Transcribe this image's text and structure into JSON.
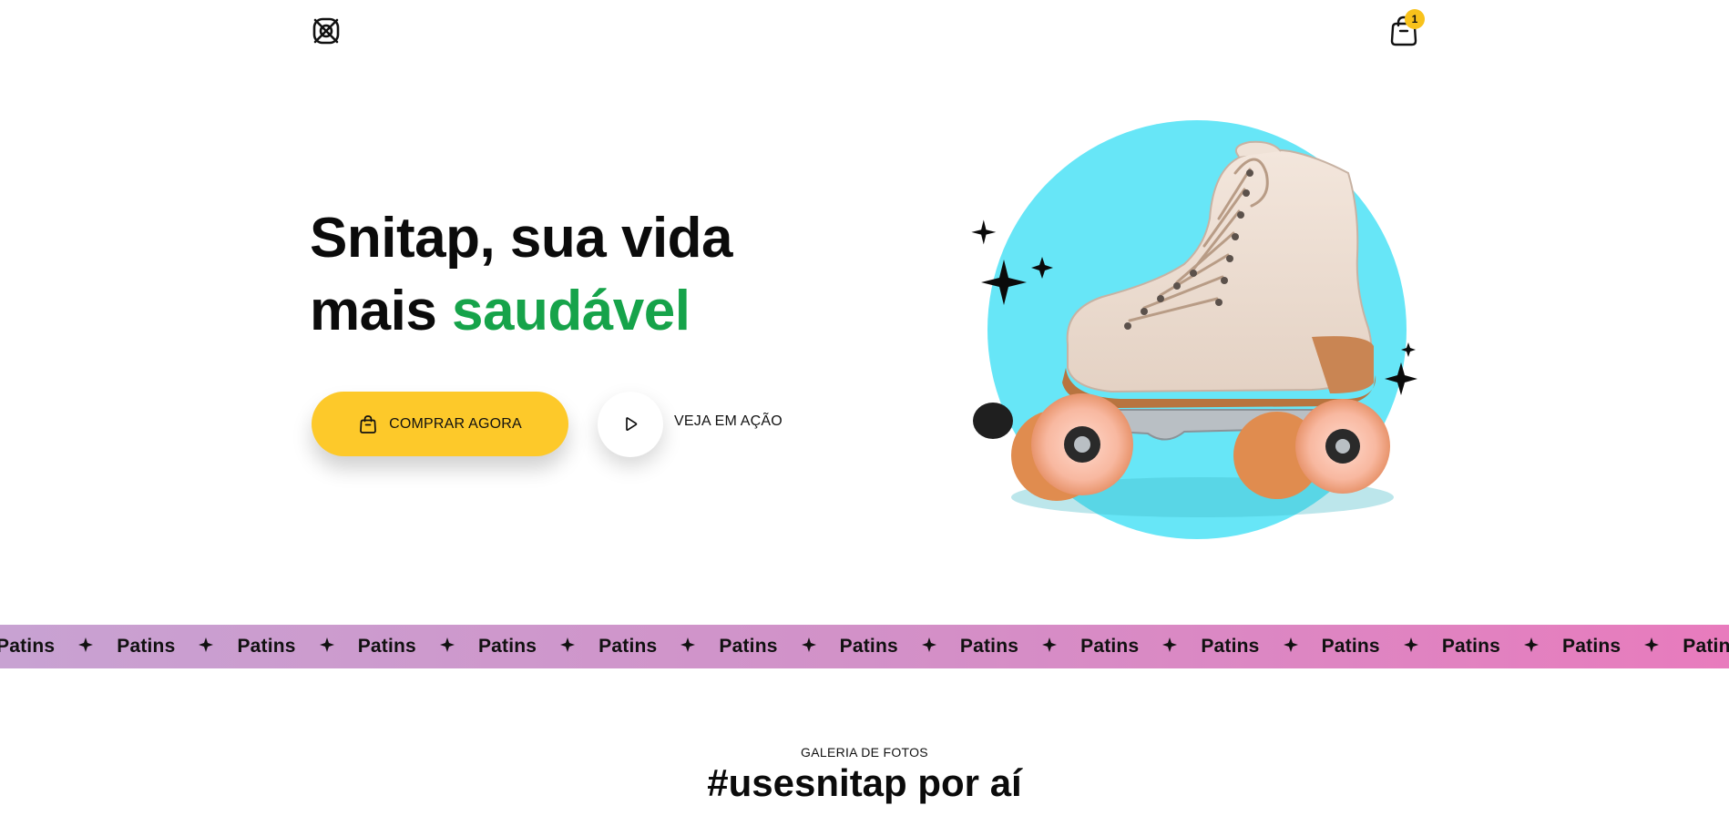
{
  "header": {
    "logo_icon": "snitap-logo-icon",
    "cart_icon": "shopping-bag-icon",
    "cart_count": "1"
  },
  "hero": {
    "title_line1": "Snitap, sua vida",
    "title_line2_plain": "mais ",
    "title_line2_accent": "saudável",
    "accent_color": "#16a34a",
    "buy_button_label": "COMPRAR AGORA",
    "buy_button_color": "#fdc92a",
    "play_button_icon": "play-icon",
    "play_label": "VEJA EM AÇÃO",
    "image_subject": "roller-skate",
    "circle_color": "#67e6f7"
  },
  "marquee": {
    "word": "Patins",
    "separator_icon": "sparkle-star-icon",
    "gradient": [
      "#c8a2d2",
      "#e87bbd"
    ]
  },
  "gallery": {
    "eyebrow": "GALERIA DE FOTOS",
    "title": "#usesnitap por aí"
  }
}
